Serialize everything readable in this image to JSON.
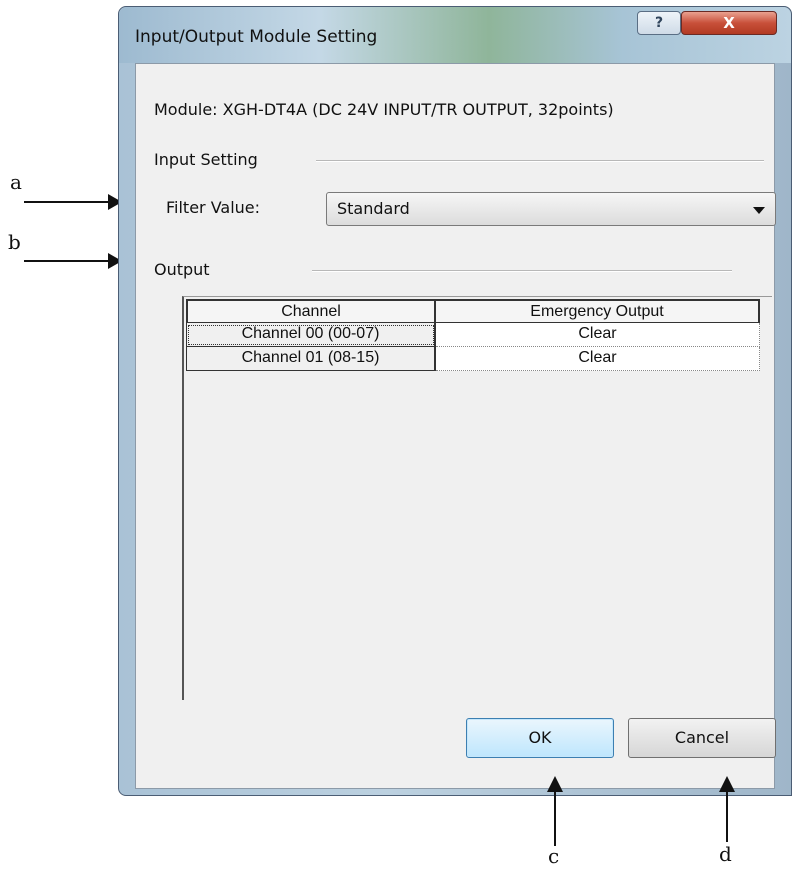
{
  "window": {
    "title": "Input/Output Module Setting",
    "help_label": "?",
    "close_label": "X"
  },
  "module": {
    "text": "Module:  XGH-DT4A (DC 24V INPUT/TR OUTPUT, 32points)"
  },
  "input_setting": {
    "label": "Input Setting",
    "filter_label": "Filter Value:",
    "filter_value": "Standard"
  },
  "output": {
    "label": "Output",
    "columns": [
      "Channel",
      "Emergency Output"
    ],
    "rows": [
      {
        "channel": "Channel 00 (00-07)",
        "emergency_output": "Clear"
      },
      {
        "channel": "Channel 01 (08-15)",
        "emergency_output": "Clear"
      }
    ]
  },
  "buttons": {
    "ok_label": "OK",
    "cancel_label": "Cancel"
  },
  "annotations": {
    "a": "a",
    "b": "b",
    "c": "c",
    "d": "d"
  }
}
